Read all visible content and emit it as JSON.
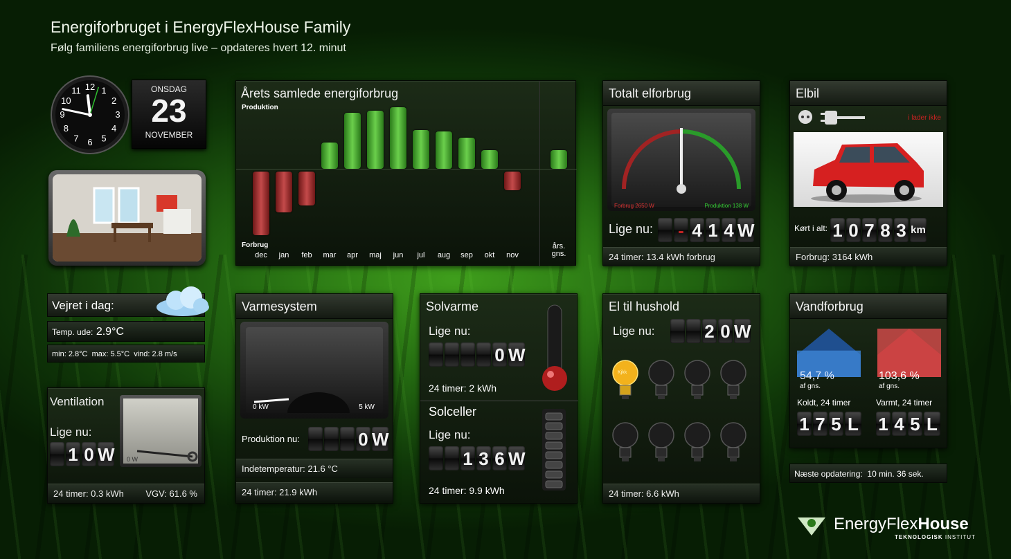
{
  "header": {
    "title": "Energiforbruget i EnergyFlexHouse Family",
    "subtitle": "Følg familiens energiforbrug live – opdateres hvert 12. minut"
  },
  "clock": {
    "hour_numbers": [
      "12",
      "1",
      "2",
      "3",
      "4",
      "5",
      "6",
      "7",
      "8",
      "9",
      "10",
      "11"
    ],
    "time": "11:47"
  },
  "calendar": {
    "weekday": "ONSDAG",
    "day": "23",
    "month": "NOVEMBER"
  },
  "weather": {
    "title": "Vejret i dag:",
    "temp_label": "Temp. ude:",
    "temp_value": "2.9°C",
    "summary": "min: 2.8°C  max: 5.5°C  vind: 2.8 m/s",
    "icon": "cloud-icon"
  },
  "ventilation": {
    "title": "Ventilation",
    "now_label": "Lige nu:",
    "digits": [
      "",
      "1",
      "0",
      "W"
    ],
    "gauge_min": "0 W",
    "gauge_fraction": 0.1,
    "footer_left": "24 timer: 0.3 kWh",
    "footer_right": "VGV: 61.6 %"
  },
  "chart": {
    "title": "Årets samlede energiforbrug",
    "produktion_label": "Produktion",
    "forbrug_label": "Forbrug",
    "avg_label_1": "års.",
    "avg_label_2": "gns."
  },
  "chart_data": {
    "type": "bar",
    "title": "Årets samlede energiforbrug",
    "categories": [
      "dec",
      "jan",
      "feb",
      "mar",
      "apr",
      "maj",
      "jun",
      "jul",
      "aug",
      "sep",
      "okt",
      "nov"
    ],
    "values": [
      -85,
      -55,
      -45,
      35,
      75,
      78,
      82,
      52,
      50,
      42,
      25,
      -25
    ],
    "average": 25,
    "ylabel_top": "Produktion",
    "ylabel_bottom": "Forbrug",
    "colors": {
      "positive": "#3aa52a",
      "negative": "#a52a2a"
    }
  },
  "total_el": {
    "title": "Totalt elforbrug",
    "gauge_left": "Forbrug 2650 W",
    "gauge_right": "Produktion 138 W",
    "needle_fraction": 0.5,
    "now_label": "Lige nu:",
    "digits": [
      "",
      "-",
      "4",
      "1",
      "4",
      "W"
    ],
    "footer": "24 timer: 13.4 kWh forbrug"
  },
  "elbil": {
    "title": "Elbil",
    "status": "i lader ikke",
    "plug_icon": "plug-icon",
    "socket_icon": "socket-icon",
    "km_label": "Kørt i alt:",
    "digits": [
      "1",
      "0",
      "7",
      "8",
      "3",
      "km"
    ],
    "footer": "Forbrug: 3164 kWh"
  },
  "varmesystem": {
    "title": "Varmesystem",
    "gauge_min": "0 kW",
    "gauge_max": "5 kW",
    "gauge_fraction": 0.0,
    "prod_label": "Produktion nu:",
    "digits": [
      "",
      "",
      "",
      "0",
      "W"
    ],
    "footer1": "Indetemperatur: 21.6 °C",
    "footer2": "24 timer: 21.9 kWh"
  },
  "solvarme": {
    "title": "Solvarme",
    "now_label": "Lige nu:",
    "digits": [
      "",
      "",
      "",
      "",
      "0",
      "W"
    ],
    "footer": "24 timer: 2 kWh",
    "thermo_fraction": 0.1
  },
  "solceller": {
    "title": "Solceller",
    "now_label": "Lige nu:",
    "digits": [
      "",
      "",
      "1",
      "3",
      "6",
      "W"
    ],
    "footer": "24 timer: 9.9 kWh",
    "level_fraction": 0.0
  },
  "el_hushold": {
    "title": "El til hushold",
    "now_label": "Lige nu:",
    "digits": [
      "",
      "",
      "2",
      "0",
      "W"
    ],
    "footer": "24 timer: 6.6 kWh",
    "bulbs_on": 1,
    "bulb_count": 8,
    "bulb_on_label": "Kjkk"
  },
  "vand": {
    "title": "Vandforbrug",
    "cold_pct": "54,7 %",
    "cold_sub": "af gns.",
    "cold_label": "Koldt, 24 timer",
    "cold_digits": [
      "1",
      "7",
      "5",
      "L"
    ],
    "cold_fraction": 0.547,
    "warm_pct": "103,6 %",
    "warm_sub": "af gns.",
    "warm_label": "Varmt, 24 timer",
    "warm_digits": [
      "1",
      "4",
      "5",
      "L"
    ],
    "warm_fraction": 1.0
  },
  "next_update": "Næste opdatering:  10 min. 36 sek.",
  "logo": {
    "name_light": "EnergyFlex",
    "name_bold": "House",
    "sub_bold": "TEKNOLOGISK",
    "sub_light": " INSTITUT"
  }
}
